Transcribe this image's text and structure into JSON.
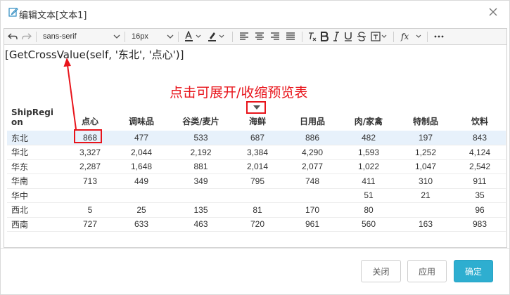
{
  "dialog": {
    "title": "编辑文本[文本1]"
  },
  "toolbar": {
    "font_family": "sans-serif",
    "font_size": "16px",
    "icons": [
      "undo-icon",
      "redo-icon",
      "font-color-icon",
      "highlight-icon",
      "align-left-icon",
      "align-center-icon",
      "align-right-icon",
      "justify-icon",
      "clear-format-icon",
      "bold-icon",
      "italic-icon",
      "underline-icon",
      "strikethrough-icon",
      "insert-field-icon",
      "formula-icon",
      "more-icon"
    ]
  },
  "editor": {
    "formula_text": "[GetCrossValue(self, '东北', '点心')]"
  },
  "annotation": {
    "hint_text": "点击可展开/收缩预览表",
    "color": "#e8141b"
  },
  "pivot": {
    "corner_header": "ShipRegion",
    "corner_line1": "ShipRegi",
    "corner_line2": "on",
    "columns": [
      "点心",
      "调味品",
      "谷类/麦片",
      "海鲜",
      "日用品",
      "肉/家禽",
      "特制品",
      "饮料"
    ],
    "rows": [
      {
        "label": "东北",
        "values": [
          "868",
          "477",
          "533",
          "687",
          "886",
          "482",
          "197",
          "843"
        ]
      },
      {
        "label": "华北",
        "values": [
          "3,327",
          "2,044",
          "2,192",
          "3,384",
          "4,290",
          "1,593",
          "1,252",
          "4,124"
        ]
      },
      {
        "label": "华东",
        "values": [
          "2,287",
          "1,648",
          "881",
          "2,014",
          "2,077",
          "1,022",
          "1,047",
          "2,542"
        ]
      },
      {
        "label": "华南",
        "values": [
          "713",
          "449",
          "349",
          "795",
          "748",
          "411",
          "310",
          "911"
        ]
      },
      {
        "label": "华中",
        "values": [
          "",
          "",
          "",
          "",
          "",
          "51",
          "21",
          "35"
        ]
      },
      {
        "label": "西北",
        "values": [
          "5",
          "25",
          "135",
          "81",
          "170",
          "80",
          "",
          "96"
        ]
      },
      {
        "label": "西南",
        "values": [
          "727",
          "633",
          "463",
          "720",
          "961",
          "560",
          "163",
          "983"
        ]
      }
    ],
    "highlight_color": "#e7f1fb"
  },
  "footer": {
    "close_label": "关闭",
    "apply_label": "应用",
    "ok_label": "确定",
    "ok_color": "#2eaed0"
  }
}
